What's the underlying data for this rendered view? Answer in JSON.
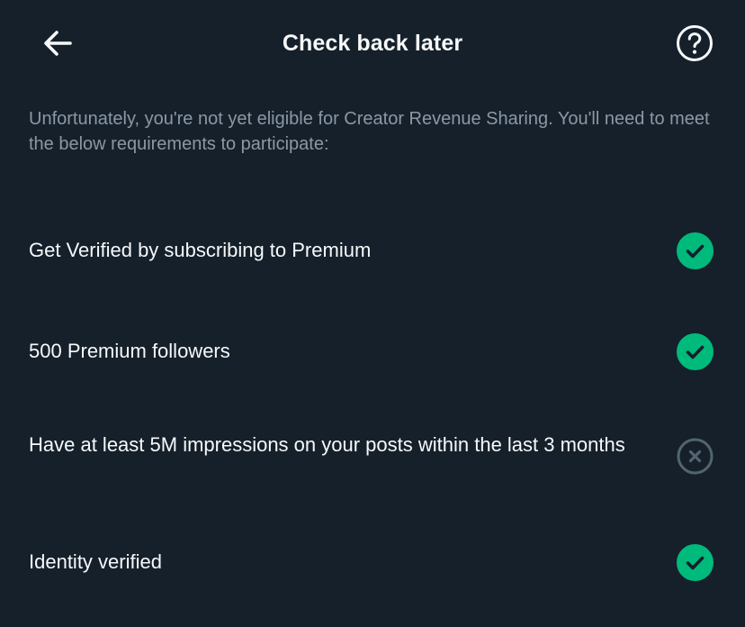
{
  "header": {
    "title": "Check back later",
    "back_icon": "arrow-left-icon",
    "help_icon": "question-circle-icon"
  },
  "intro_text": "Unfortunately, you're not yet eligible for Creator Revenue Sharing. You'll need to meet the below requirements to participate:",
  "requirements": [
    {
      "label": "Get Verified by subscribing to Premium",
      "met": true,
      "icon": "check-circle-icon"
    },
    {
      "label": "500 Premium followers",
      "met": true,
      "icon": "check-circle-icon"
    },
    {
      "label": "Have at least 5M impressions on your posts within the last 3 months",
      "met": false,
      "icon": "x-circle-icon"
    },
    {
      "label": "Identity verified",
      "met": true,
      "icon": "check-circle-icon"
    }
  ],
  "colors": {
    "background": "#15202b",
    "text_primary": "#f7f9f9",
    "text_secondary": "#8b98a5",
    "success": "#00ba7c",
    "unmet": "#536471"
  }
}
